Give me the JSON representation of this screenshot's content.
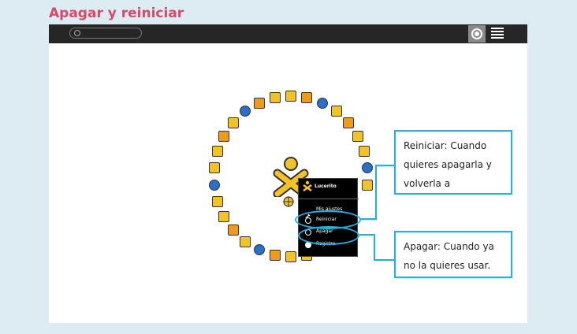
{
  "slide_title": "Apagar y reiniciar",
  "palette": {
    "user_name": "Lucerito",
    "items": [
      "Mis ajustes",
      "Reiniciar",
      "Apagar",
      "Registro"
    ]
  },
  "callouts": {
    "reiniciar": "Reiniciar: Cuando quieres apagarla y volverla a",
    "apagar": "Apagar: Cuando ya no la quieres usar."
  },
  "colors": {
    "accent": "#1ab3ea",
    "title": "#d94a6a",
    "topbar": "#262626",
    "xo": "#f3c224"
  },
  "icons": [
    "search-icon",
    "home-view-icon",
    "list-view-icon",
    "xo-icon",
    "settings-icon",
    "restart-icon",
    "shutdown-icon",
    "logout-icon"
  ]
}
